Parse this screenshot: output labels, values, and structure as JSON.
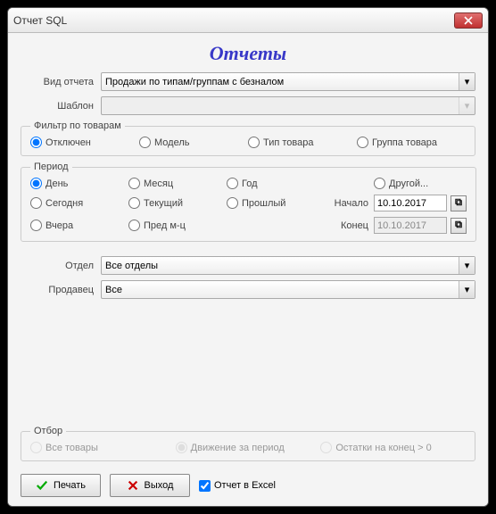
{
  "window": {
    "title": "Отчет SQL"
  },
  "heading": "Отчеты",
  "report_type": {
    "label": "Вид отчета",
    "value": "Продажи по типам/группам с безналом"
  },
  "template": {
    "label": "Шаблон",
    "value": ""
  },
  "filter": {
    "legend": "Фильтр по товарам",
    "options": {
      "off": "Отключен",
      "model": "Модель",
      "type": "Тип товара",
      "group": "Группа товара"
    },
    "selected": "off"
  },
  "period": {
    "legend": "Период",
    "options": {
      "day": "День",
      "month": "Месяц",
      "year": "Год",
      "today": "Сегодня",
      "current": "Текущий",
      "last": "Прошлый",
      "yesterday": "Вчера",
      "prevmonth": "Пред м-ц",
      "other": "Другой..."
    },
    "selected": "day",
    "start_label": "Начало",
    "start_value": "10.10.2017",
    "end_label": "Конец",
    "end_value": "10.10.2017"
  },
  "department": {
    "label": "Отдел",
    "value": "Все отделы"
  },
  "seller": {
    "label": "Продавец",
    "value": "Все"
  },
  "selection": {
    "legend": "Отбор",
    "options": {
      "all": "Все товары",
      "movement": "Движение за период",
      "stock": "Остатки на конец > 0"
    },
    "selected": "movement"
  },
  "buttons": {
    "print": "Печать",
    "exit": "Выход",
    "excel": "Отчет в Excel"
  }
}
